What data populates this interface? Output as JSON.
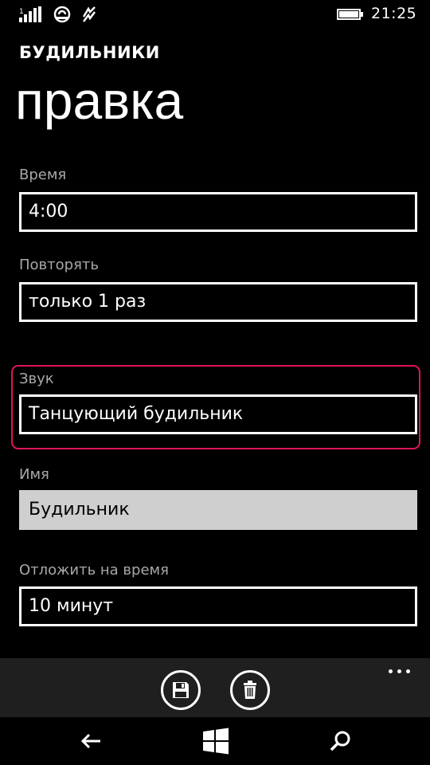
{
  "status_bar": {
    "time": "21:25",
    "icons": [
      "signal-icon",
      "nfc-icon",
      "data-connection-icon",
      "battery-icon"
    ]
  },
  "header": {
    "app_title": "БУДИЛЬНИКИ",
    "page_title": "правка"
  },
  "form": {
    "time": {
      "label": "Время",
      "value": "4:00"
    },
    "repeat": {
      "label": "Повторять",
      "value": "только 1 раз"
    },
    "sound": {
      "label": "Звук",
      "value": "Танцующий будильник"
    },
    "name": {
      "label": "Имя",
      "value": "Будильник"
    },
    "snooze": {
      "label": "Отложить на время",
      "value": "10 минут"
    }
  },
  "app_bar": {
    "buttons": [
      "save-icon",
      "delete-icon"
    ],
    "more_icon": "ellipsis-icon"
  },
  "nav_bar": {
    "buttons": [
      "back-icon",
      "windows-start-icon",
      "search-icon"
    ]
  },
  "colors": {
    "background": "#000000",
    "label": "#a8a8a8",
    "highlight": "#e0135d",
    "app_bar": "#1f1f1f",
    "filled_field": "#cfcfcf"
  }
}
